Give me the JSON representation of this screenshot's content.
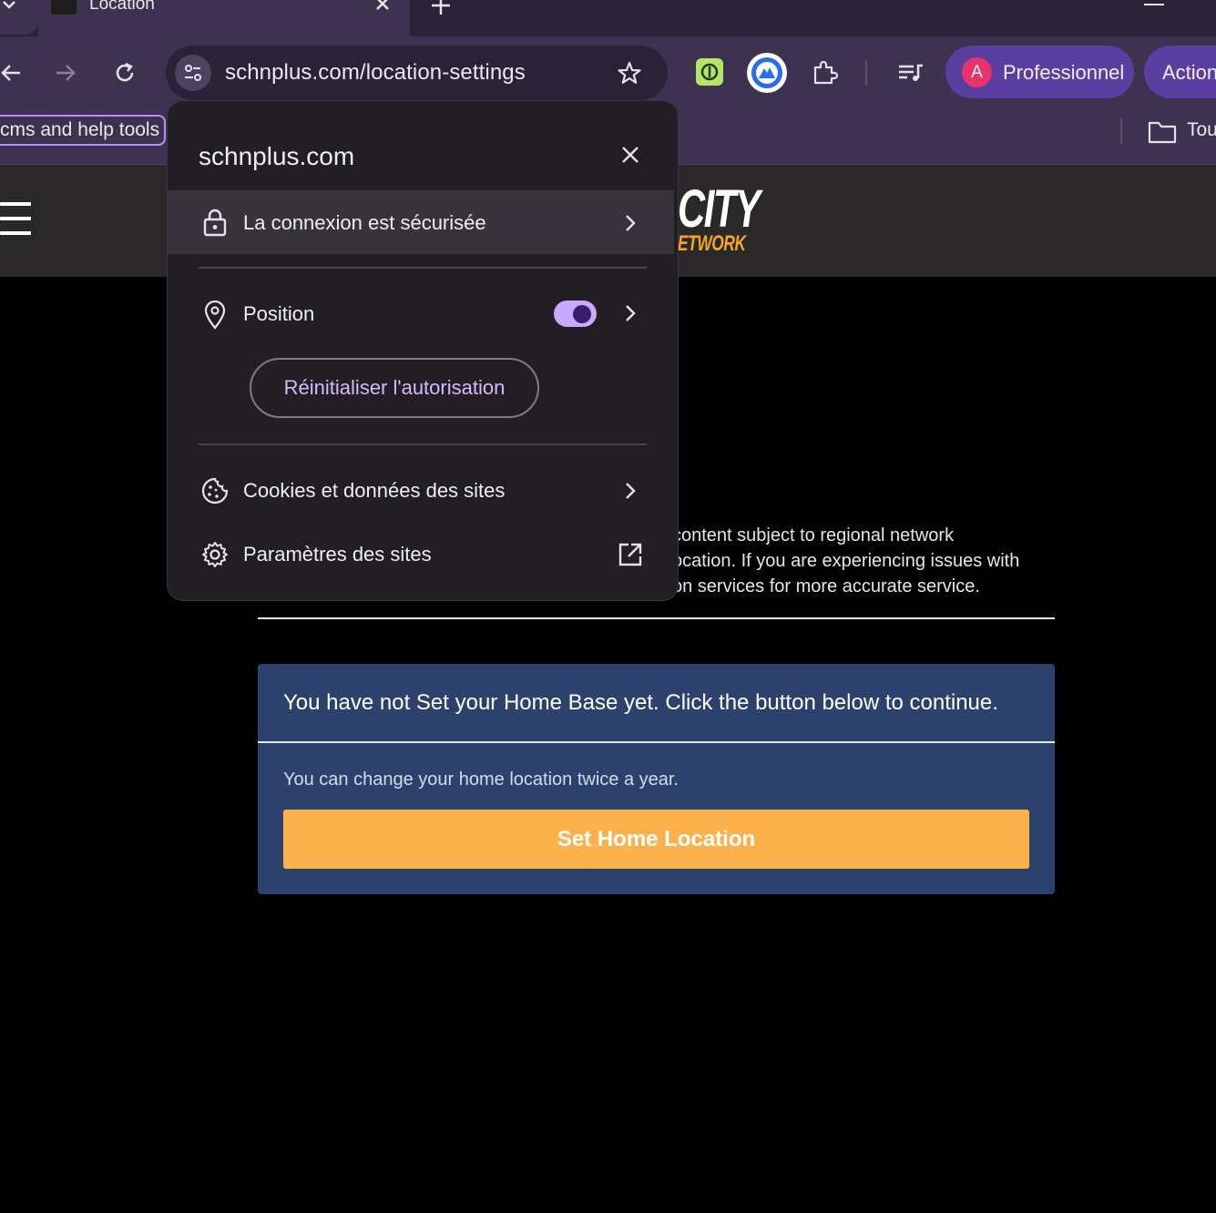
{
  "browser": {
    "tab_title": "Location",
    "url": "schnplus.com/location-settings",
    "profile_label": "Professionnel",
    "profile_initial": "A",
    "action_label": "Action",
    "bookmarks": [
      {
        "label": "cms and help tools"
      },
      {
        "label": "Tou"
      }
    ]
  },
  "site_info_popup": {
    "domain": "schnplus.com",
    "connection_label": "La connexion est sécurisée",
    "position_label": "Position",
    "position_enabled": true,
    "reset_button": "Réinitialiser l'autorisation",
    "cookies_label": "Cookies et données des sites",
    "site_settings_label": "Paramètres des sites"
  },
  "site": {
    "logo_text": "CITY",
    "logo_sub": "ETWORK",
    "description": "content subject to regional network\nocation. If you are experiencing issues with\non services for more accurate service.",
    "home_base": {
      "title": "You have not Set your Home Base yet. Click the button below to continue.",
      "note": "You can change your home location twice a year.",
      "button_label": "Set Home Location"
    }
  },
  "colors": {
    "browser_chrome": "#3d3250",
    "popup_bg": "#211f24",
    "toggle_on": "#c9a8ff",
    "card_bg": "#2c426d",
    "cta_button": "#fbb24c"
  }
}
